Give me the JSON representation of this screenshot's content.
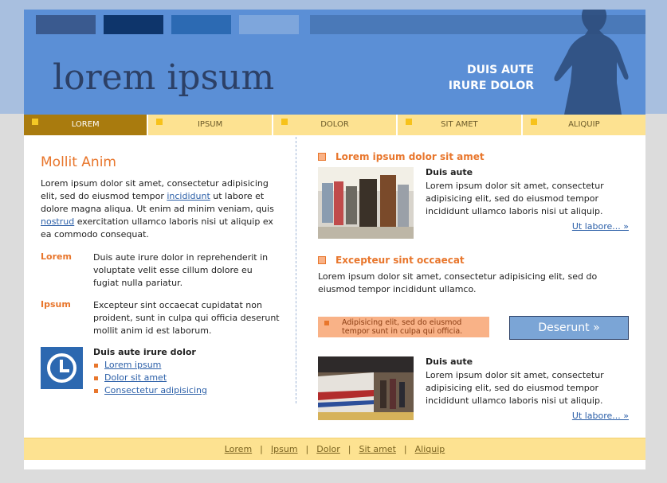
{
  "header": {
    "logo": "lorem ipsum",
    "tagline_line1": "DUIS AUTE",
    "tagline_line2": "IRURE DOLOR",
    "swatch_colors": [
      "#3a5a8f",
      "#0e356b",
      "#2c6ab3",
      "#7ea6dc",
      "#4a79b8"
    ]
  },
  "nav": {
    "items": [
      {
        "label": "LOREM",
        "active": true
      },
      {
        "label": "IPSUM",
        "active": false
      },
      {
        "label": "DOLOR",
        "active": false
      },
      {
        "label": "SIT AMET",
        "active": false
      },
      {
        "label": "ALIQUIP",
        "active": false
      }
    ]
  },
  "left": {
    "title": "Mollit Anim",
    "intro_part1": "Lorem ipsum dolor sit amet, consectetur adipisicing elit, sed do eiusmod tempor ",
    "intro_link1": "incididunt",
    "intro_part2": " ut labore et dolore magna aliqua. Ut enim ad minim veniam, quis ",
    "intro_link2": "nostrud",
    "intro_part3": " exercitation ullamco laboris nisi ut aliquip ex ea commodo consequat.",
    "defs": [
      {
        "term": "Lorem",
        "desc": "Duis aute irure dolor in reprehenderit in voluptate velit esse cillum dolore eu fugiat nulla pariatur."
      },
      {
        "term": "Ipsum",
        "desc": "Excepteur sint occaecat cupidatat non proident, sunt in culpa qui officia deserunt mollit anim id est laborum."
      }
    ],
    "links_title": "Duis aute irure dolor",
    "links": [
      "Lorem ipsum",
      "Dolor sit amet",
      "Consectetur adipisicing"
    ]
  },
  "right": {
    "section1_title": "Lorem ipsum dolor sit amet",
    "item1_heading": "Duis aute",
    "item1_text": "Lorem ipsum dolor sit amet, consectetur adipisicing elit, sed do eiusmod tempor incididunt ullamco laboris nisi ut aliquip.",
    "item1_more": "Ut labore... »",
    "section2_title": "Excepteur sint occaecat",
    "section2_text": "Lorem ipsum dolor sit amet, consectetur adipisicing elit, sed do eiusmod tempor incididunt ullamco.",
    "note": "Adipisicing elit, sed do eiusmod tempor sunt in culpa qui officia.",
    "button": "Deserunt »",
    "item2_heading": "Duis aute",
    "item2_text": "Lorem ipsum dolor sit amet, consectetur adipisicing elit, sed do eiusmod tempor incididunt ullamco laboris nisi ut aliquip.",
    "item2_more": "Ut labore... »"
  },
  "footer": {
    "links": [
      "Lorem",
      "Ipsum",
      "Dolor",
      "Sit amet",
      "Aliquip"
    ],
    "separator": "|"
  }
}
